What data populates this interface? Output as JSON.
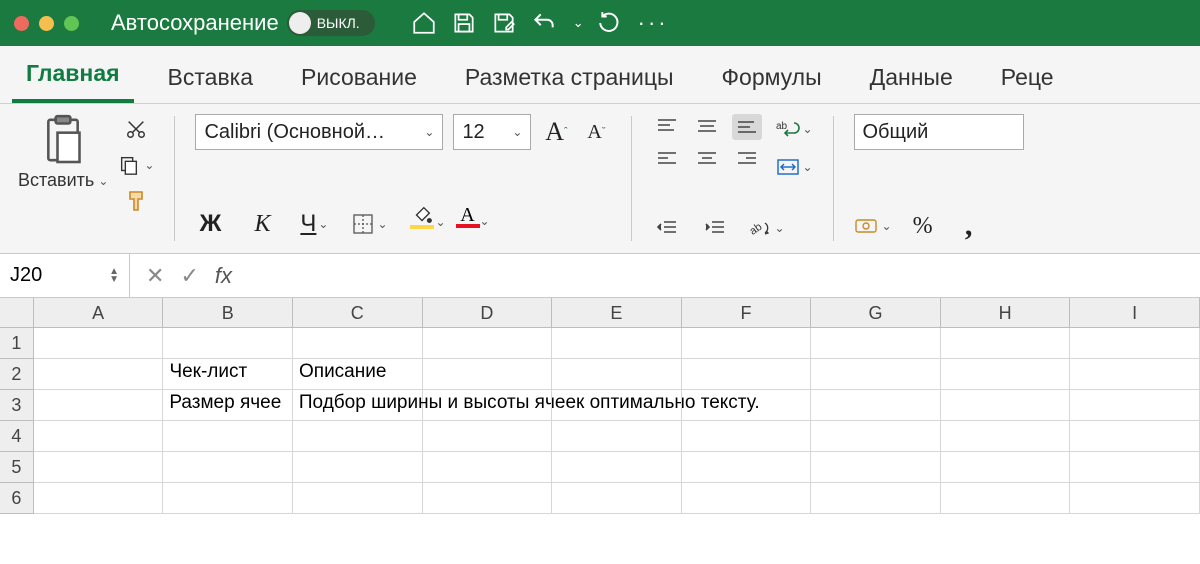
{
  "titlebar": {
    "autosave_label": "Автосохранение",
    "toggle_state": "ВЫКЛ."
  },
  "tabs": [
    "Главная",
    "Вставка",
    "Рисование",
    "Разметка страницы",
    "Формулы",
    "Данные",
    "Реце"
  ],
  "active_tab": 0,
  "ribbon": {
    "paste_label": "Вставить",
    "font_name": "Calibri (Основной…",
    "font_size": "12",
    "number_format": "Общий",
    "bold": "Ж",
    "italic": "К",
    "underline": "Ч"
  },
  "formula_bar": {
    "name_box": "J20",
    "fx": "fx",
    "input": ""
  },
  "grid": {
    "columns": [
      "A",
      "B",
      "C",
      "D",
      "E",
      "F",
      "G",
      "H",
      "I"
    ],
    "rows": [
      {
        "n": "1",
        "cells": [
          "",
          "",
          "",
          "",
          "",
          "",
          "",
          "",
          ""
        ]
      },
      {
        "n": "2",
        "cells": [
          "",
          "Чек-лист",
          "Описание",
          "",
          "",
          "",
          "",
          "",
          ""
        ]
      },
      {
        "n": "3",
        "cells": [
          "",
          "Размер ячее",
          "Подбор ширины и высоты ячеек оптимально тексту.",
          "",
          "",
          "",
          "",
          "",
          ""
        ],
        "spill_col": 2
      },
      {
        "n": "4",
        "cells": [
          "",
          "",
          "",
          "",
          "",
          "",
          "",
          "",
          ""
        ]
      },
      {
        "n": "5",
        "cells": [
          "",
          "",
          "",
          "",
          "",
          "",
          "",
          "",
          ""
        ]
      },
      {
        "n": "6",
        "cells": [
          "",
          "",
          "",
          "",
          "",
          "",
          "",
          "",
          ""
        ]
      }
    ]
  }
}
